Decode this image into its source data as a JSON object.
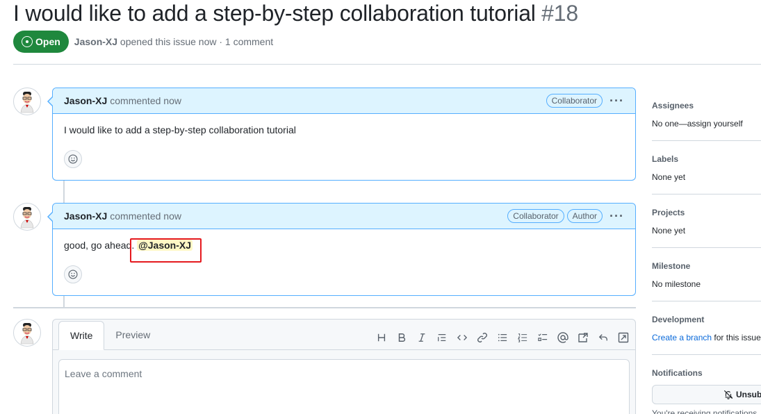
{
  "issue": {
    "title": "I would like to add a step-by-step collaboration tutorial",
    "number": "#18",
    "state": "Open",
    "opened_by": "Jason-XJ",
    "opened_text": "opened this issue now · 1 comment"
  },
  "comments": [
    {
      "author": "Jason-XJ",
      "action": "commented now",
      "labels": [
        "Collaborator"
      ],
      "body": "I would like to add a step-by-step collaboration tutorial"
    },
    {
      "author": "Jason-XJ",
      "action": "commented now",
      "labels": [
        "Collaborator",
        "Author"
      ],
      "body_prefix": "good, go ahead. ",
      "mention": "@Jason-XJ"
    }
  ],
  "editor": {
    "tabs": [
      "Write",
      "Preview"
    ],
    "placeholder": "Leave a comment",
    "toolbar_icons": [
      "heading-icon",
      "bold-icon",
      "italic-icon",
      "quote-icon",
      "code-icon",
      "link-icon",
      "unordered-list-icon",
      "ordered-list-icon",
      "task-list-icon",
      "mention-icon",
      "cross-reference-icon",
      "reply-icon",
      "fullscreen-icon"
    ]
  },
  "sidebar": {
    "assignees": {
      "title": "Assignees",
      "value": "No one—assign yourself"
    },
    "labels": {
      "title": "Labels",
      "value": "None yet"
    },
    "projects": {
      "title": "Projects",
      "value": "None yet"
    },
    "milestone": {
      "title": "Milestone",
      "value": "No milestone"
    },
    "development": {
      "title": "Development",
      "link": "Create a branch",
      "suffix": "for this issue"
    },
    "notifications": {
      "title": "Notifications",
      "button": "Unsub",
      "note": "You're receiving notifications"
    }
  },
  "colors": {
    "open_green": "#1f883d",
    "highlight_border": "#54aeff",
    "highlight_header_bg": "#ddf4ff",
    "mention_bg": "#fff8c5",
    "annotation_red": "#e5191e",
    "link_blue": "#0969da"
  }
}
